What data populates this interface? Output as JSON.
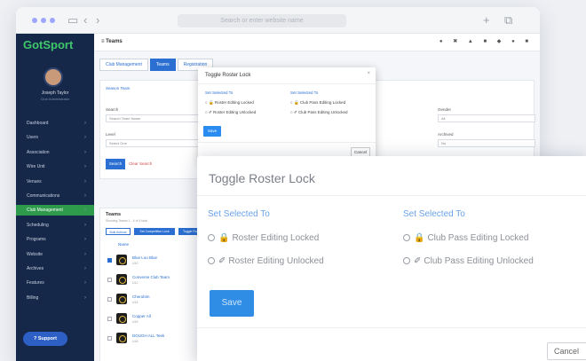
{
  "browser": {
    "url_placeholder": "Search or enter website name"
  },
  "sidebar": {
    "brand": "GotSport",
    "user_name": "Joseph Taylor",
    "user_role": "Club Administrator",
    "items": [
      {
        "label": "Dashboard",
        "active": false
      },
      {
        "label": "Users",
        "active": false
      },
      {
        "label": "Association",
        "active": false
      },
      {
        "label": "Wire Unit",
        "active": false
      },
      {
        "label": "Venues",
        "active": false
      },
      {
        "label": "Communications",
        "active": false
      },
      {
        "label": "Club Management",
        "active": true
      },
      {
        "label": "Scheduling",
        "active": false
      },
      {
        "label": "Programs",
        "active": false
      },
      {
        "label": "Website",
        "active": false
      },
      {
        "label": "Archives",
        "active": false
      },
      {
        "label": "Features",
        "active": false
      },
      {
        "label": "Billing",
        "active": false
      }
    ],
    "support_label": "Support"
  },
  "topbar": {
    "title": "Teams",
    "icons_text": "● ✖ ▲ ■ ◆ ● ■"
  },
  "main": {
    "tabs": [
      {
        "label": "Club Management",
        "active": false
      },
      {
        "label": "Teams",
        "active": true
      },
      {
        "label": "Registration",
        "active": false
      }
    ],
    "breadcrumb": "Season  Team",
    "search_label": "Search",
    "search_placeholder": "Search Team Name",
    "level_label": "Level",
    "level_value": "Select One",
    "gender_label": "Gender",
    "gender_value": "All",
    "archived_label": "Archived",
    "archived_value": "No",
    "search_button": "Search",
    "clear_link": "Clear Search",
    "teams_heading": "Teams",
    "teams_sub": "Showing Teams 1 - 4 of 4 total",
    "actions": [
      "Bulk Actions",
      "Set Competition Lock",
      "Toggle Roster Lock"
    ],
    "col_name": "Name",
    "rows": [
      {
        "name": "Blue Lou Blue",
        "sub": "U10",
        "checked": true
      },
      {
        "name": "Converse Club Team",
        "sub": "U12",
        "checked": false
      },
      {
        "name": "Cherubim",
        "sub": "U14",
        "checked": false
      },
      {
        "name": "Copper All",
        "sub": "U15",
        "checked": false
      },
      {
        "name": "DOUGH ALL Teek",
        "sub": "U16",
        "checked": false
      }
    ]
  },
  "mini_modal": {
    "title": "Toggle Roster Lock",
    "close": "×",
    "left_heading": "Set Selected To",
    "right_heading": "Set Selected To",
    "left_options": [
      "🔒 Roster Editing Locked",
      "✐ Roster Editing Unlocked"
    ],
    "right_options": [
      "🔒 Club Pass Editing Locked",
      "✐ Club Pass Editing Unlocked"
    ],
    "save": "Save",
    "cancel": "Cancel"
  },
  "big_modal": {
    "title": "Toggle Roster Lock",
    "left_heading": "Set Selected To",
    "right_heading": "Set Selected To",
    "left_options": [
      {
        "icon": "lock-icon",
        "glyph": "🔒",
        "label": "Roster Editing Locked"
      },
      {
        "icon": "pencil-icon",
        "glyph": "✐",
        "label": "Roster Editing Unlocked"
      }
    ],
    "right_options": [
      {
        "icon": "lock-icon",
        "glyph": "🔒",
        "label": "Club Pass Editing Locked"
      },
      {
        "icon": "pencil-icon",
        "glyph": "✐",
        "label": "Club Pass Editing Unlocked"
      }
    ],
    "save": "Save",
    "cancel": "Cancel"
  },
  "colors": {
    "sidebar_bg": "#16284a",
    "active_nav": "#2d9a4c",
    "brand_green": "#3ec86a",
    "primary_blue": "#2f8de6"
  }
}
